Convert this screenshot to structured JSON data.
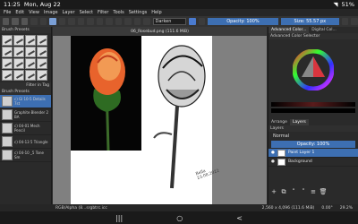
{
  "status": {
    "time": "11:25",
    "date": "Mon, Aug 22",
    "battery": "51%"
  },
  "menu": [
    "File",
    "Edit",
    "View",
    "Image",
    "Layer",
    "Select",
    "Filter",
    "Tools",
    "Settings",
    "Help"
  ],
  "toolbar": {
    "blend_mode": "Darken",
    "opacity_label": "Opacity: 100%",
    "size_label": "Size: 55.57 px"
  },
  "left_panel": {
    "header": "Brush Presets",
    "filter_label": "Filter in Tag",
    "brush_header": "Brush Presets",
    "presets": [
      {
        "label": "c) Gl 10-5 Details 7st"
      },
      {
        "label": "Graphite Blender 2 BA"
      },
      {
        "label": "c) 04-01 Mech Pencil"
      },
      {
        "label": "c) 04-13 5 Triangle"
      },
      {
        "label": "c) 04-10 _5 Tone Sm"
      }
    ]
  },
  "canvas": {
    "tab_title": "06_Rosebud.png (111.6 MiB)",
    "signature": "Bella 23.08.2022"
  },
  "footer": {
    "color_info": "RGB/Alpha (8...srgbtrc.icc",
    "dims": "2,560 x 4,096 (111.6 MiB)",
    "rotation": "0.00°",
    "zoom": "29.2%"
  },
  "right_panel": {
    "color_tabs": [
      "Advanced Color...",
      "Digital Col..."
    ],
    "color_selector_label": "Advanced Color Selector",
    "layer_tabs": [
      "Arrange",
      "Layers"
    ],
    "layers_header": "Layers",
    "blend_normal": "Normal",
    "layer_opacity": "Opacity: 100%",
    "layers": [
      {
        "name": "Paint Layer 1"
      },
      {
        "name": "Background"
      }
    ]
  }
}
